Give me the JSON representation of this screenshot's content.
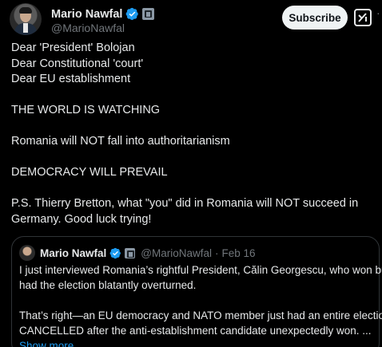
{
  "author": {
    "name": "Mario Nawfal",
    "handle": "@MarioNawfal",
    "verified_color": "#1d9bf0"
  },
  "actions": {
    "subscribe_label": "Subscribe",
    "grok_icon": "grok-icon",
    "more_label": "···"
  },
  "body": {
    "lines": [
      "Dear 'President' Bolojan",
      "Dear Constitutional 'court'",
      "Dear EU establishment",
      "THE WORLD IS WATCHING",
      "Romania will NOT fall into authoritarianism",
      "DEMOCRACY WILL PREVAIL",
      "P.S. Thierry Bretton, what \"you\" did in Romania will NOT succeed in",
      "Germany. Good luck trying!"
    ]
  },
  "quote": {
    "name": "Mario Nawfal",
    "handle": "@MarioNawfal",
    "separator": "·",
    "date": "Feb 16",
    "lines": [
      "I just interviewed Romania’s rightful President, Călin Georgescu, who won but",
      "had the election blatantly overturned.",
      "That’s right—an EU democracy and NATO member just had an entire election",
      "CANCELLED after the anti-establishment candidate unexpectedly won. ..."
    ],
    "show_more": "Show more"
  },
  "colors": {
    "background": "#000000",
    "text": "#e7e9ea",
    "secondary": "#71767b",
    "link": "#1d9bf0",
    "border": "#2f3336"
  }
}
